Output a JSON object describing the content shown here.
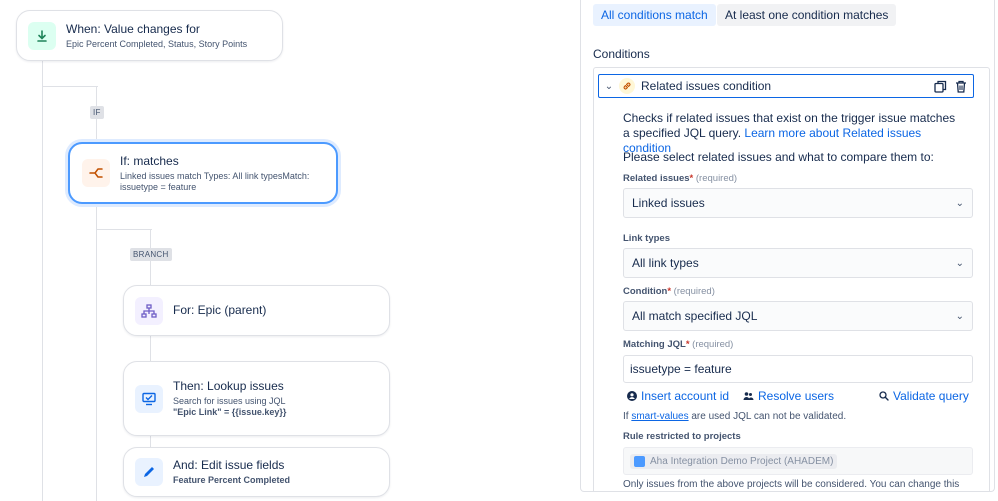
{
  "flow": {
    "trigger": {
      "title": "When: Value changes for",
      "subtitle": "Epic Percent Completed, Status, Story Points"
    },
    "if_tag": "IF",
    "condition": {
      "title": "If: matches",
      "subtitle": "Linked issues match Types: All link typesMatch: issuetype = feature"
    },
    "branch_tag": "BRANCH",
    "branch": {
      "title": "For: Epic (parent)"
    },
    "action_lookup": {
      "title": "Then: Lookup issues",
      "subtitle_line1": "Search for issues using JQL",
      "subtitle_line2": "\"Epic Link\" = {{issue.key}}"
    },
    "action_edit": {
      "title": "And: Edit issue fields",
      "subtitle": "Feature Percent Completed"
    }
  },
  "panel": {
    "match_all": "All conditions match",
    "match_any": "At least one condition matches",
    "conditions_title": "Conditions",
    "condition_header": "Related issues condition",
    "description_prefix": "Checks if related issues that exist on the trigger issue matches a specified JQL query.",
    "learn_more": "Learn more about Related issues condition",
    "instruction": "Please select related issues and what to compare them to:",
    "related_issues": {
      "label": "Related issues",
      "required": "(required)",
      "value": "Linked issues"
    },
    "link_types": {
      "label": "Link types",
      "value": "All link types"
    },
    "condition": {
      "label": "Condition",
      "required": "(required)",
      "value": "All match specified JQL"
    },
    "matching_jql": {
      "label": "Matching JQL",
      "required": "(required)",
      "value": "issuetype = feature"
    },
    "insert_account": "Insert account id",
    "resolve_users": "Resolve users",
    "validate_query": "Validate query",
    "note_prefix": "If",
    "note_link": "smart-values",
    "note_suffix": "are used JQL can not be validated.",
    "rule_restricted_label": "Rule restricted to projects",
    "project_chip": "Aha Integration Demo Project (AHADEM)",
    "footer_text": "Only issues from the above projects will be considered. You can change this"
  },
  "colors": {
    "accent": "#0c66e4",
    "selected_border": "#4c9aff",
    "required": "#c9372c"
  }
}
